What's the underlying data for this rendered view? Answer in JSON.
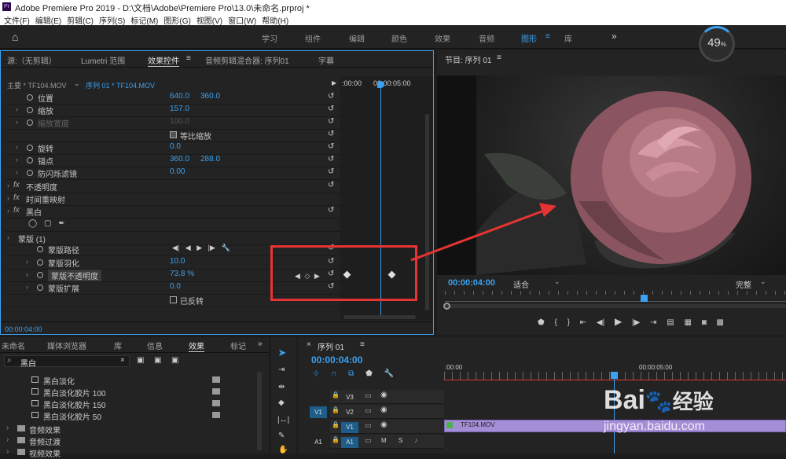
{
  "titlebar": {
    "title": "Adobe Premiere Pro 2019 - D:\\文档\\Adobe\\Premiere Pro\\13.0\\未命名.prproj *",
    "percent": "49",
    "percent_unit": "%"
  },
  "menu": [
    "文件(F)",
    "编辑(E)",
    "剪辑(C)",
    "序列(S)",
    "标记(M)",
    "图形(G)",
    "视图(V)",
    "窗口(W)",
    "帮助(H)"
  ],
  "workspaces": [
    "学习",
    "组件",
    "编辑",
    "颜色",
    "效果",
    "音频",
    "图形",
    "库"
  ],
  "active_workspace": "图形",
  "ec": {
    "tabs": [
      "源:（无剪辑）",
      "Lumetri 范围",
      "效果控件",
      "音频剪辑混合器: 序列01",
      "字幕"
    ],
    "master": "主要 * TF104.MOV",
    "seq": "序列 01 * TF104.MOV",
    "ruler": [
      ":00:00",
      "00:00:05:00"
    ],
    "props": [
      {
        "n": "位置",
        "v1": "640.0",
        "v2": "360.0"
      },
      {
        "n": "缩放",
        "v1": "157.0",
        "v2": ""
      },
      {
        "n": "缩放宽度",
        "v1": "100.0",
        "v2": ""
      },
      {
        "n": "等比缩放",
        "v1": "",
        "v2": ""
      },
      {
        "n": "旋转",
        "v1": "0.0",
        "v2": ""
      },
      {
        "n": "锚点",
        "v1": "360.0",
        "v2": "288.0"
      },
      {
        "n": "防闪烁滤镜",
        "v1": "0.00",
        "v2": ""
      },
      {
        "n": "不透明度",
        "v1": "",
        "v2": ""
      },
      {
        "n": "时间重映射",
        "v1": "",
        "v2": ""
      },
      {
        "n": "黑白",
        "v1": "",
        "v2": ""
      },
      {
        "n": "",
        "v1": "",
        "v2": ""
      },
      {
        "n": "蒙版 (1)",
        "v1": "",
        "v2": ""
      },
      {
        "n": "蒙版路径",
        "v1": "",
        "v2": ""
      },
      {
        "n": "蒙版羽化",
        "v1": "10.0",
        "v2": ""
      },
      {
        "n": "蒙版不透明度",
        "v1": "73.8 %",
        "v2": ""
      },
      {
        "n": "蒙版扩展",
        "v1": "0.0",
        "v2": ""
      },
      {
        "n": "已反转",
        "v1": "",
        "v2": ""
      }
    ],
    "timecode": "00:00:04:00"
  },
  "program": {
    "title": "节目: 序列 01",
    "timecode": "00:00:04:00",
    "fit": "适合",
    "quality": "完整"
  },
  "effects": {
    "tabs": [
      "未命名",
      "媒体浏览器",
      "库",
      "信息",
      "效果",
      "标记"
    ],
    "search": "黑白",
    "items": [
      "黑白淡化",
      "黑白淡化胶片 100",
      "黑白淡化胶片 150",
      "黑白淡化胶片 50"
    ],
    "folders": [
      "音频效果",
      "音频过渡",
      "视频效果"
    ]
  },
  "timeline": {
    "title": "序列 01",
    "timecode": "00:00:04:00",
    "ruler": [
      ":00:00",
      "00:00:05:00"
    ],
    "tracks": [
      "V3",
      "V2",
      "V1",
      "A1"
    ],
    "src": [
      "V1",
      "A1"
    ],
    "clip": "TF104.MOV",
    "m": "M",
    "s": "S"
  },
  "watermark": {
    "brand": "Bai",
    "brand2": "经验",
    "url": "jingyan.baidu.com"
  }
}
